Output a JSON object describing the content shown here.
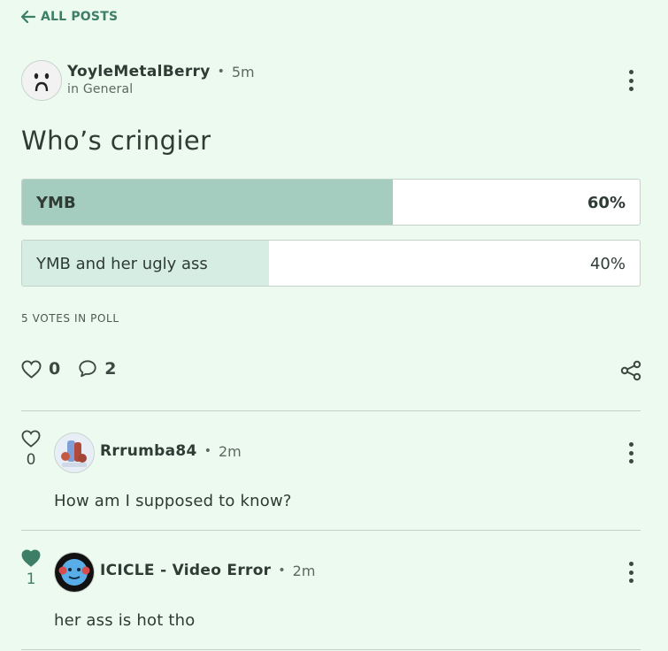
{
  "nav": {
    "back_label": "ALL POSTS"
  },
  "post": {
    "author": "YoyleMetalBerry",
    "time": "5m",
    "category": "in General",
    "title": "Who’s cringier",
    "poll": {
      "options": [
        {
          "label": "YMB",
          "percent_label": "60%",
          "fraction": 0.6
        },
        {
          "label": "YMB and her ugly ass",
          "percent_label": "40%",
          "fraction": 0.4
        }
      ],
      "votes_label": "5 VOTES IN POLL"
    },
    "likes": "0",
    "comments": "2"
  },
  "comments": [
    {
      "author": "Rrrumba84",
      "time": "2m",
      "body": "How am I supposed to know?",
      "likes": "0",
      "liked": false
    },
    {
      "author": "ICICLE - Video Error",
      "time": "2m",
      "body": "her ass is hot tho",
      "likes": "1",
      "liked": true
    }
  ],
  "colors": {
    "accent": "#3d7e67",
    "poll_lead_fill": "#a5cdbf",
    "poll_other_fill": "#d6ede3",
    "background": "#ecfaef"
  },
  "icons": {
    "back": "arrow-left-icon",
    "like": "heart-icon",
    "comment": "speech-bubble-icon",
    "share": "share-icon",
    "more": "more-vertical-icon"
  }
}
